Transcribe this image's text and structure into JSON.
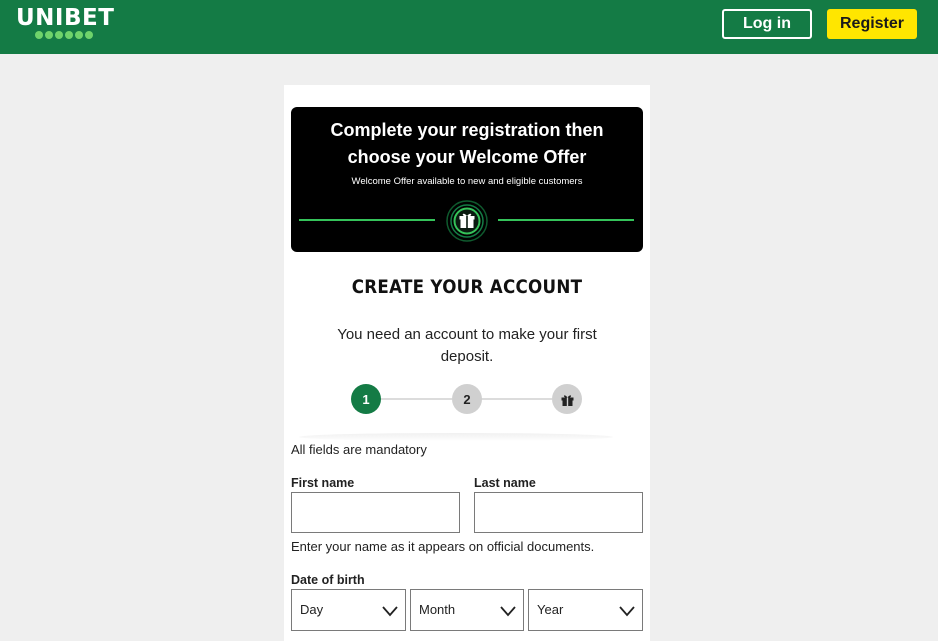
{
  "header": {
    "logo_text": "UNIBET",
    "login_label": "Log in",
    "register_label": "Register",
    "brand_color": "#147b45",
    "register_color": "#ffe600"
  },
  "banner": {
    "title_line1": "Complete your registration then",
    "title_line2": "choose your Welcome Offer",
    "subtitle": "Welcome Offer available to new and eligible customers",
    "icon": "gift-icon"
  },
  "form": {
    "heading": "CREATE YOUR ACCOUNT",
    "intro": "You need an account to make your first deposit.",
    "steps": [
      {
        "label": "1",
        "state": "active"
      },
      {
        "label": "2",
        "state": "inactive"
      },
      {
        "icon": "gift-icon",
        "state": "inactive"
      }
    ],
    "mandatory_note": "All fields are mandatory",
    "first_name": {
      "label": "First name",
      "value": ""
    },
    "last_name": {
      "label": "Last name",
      "value": ""
    },
    "name_hint": "Enter your name as it appears on official documents.",
    "dob": {
      "label": "Date of birth",
      "day": "Day",
      "month": "Month",
      "year": "Year"
    }
  }
}
